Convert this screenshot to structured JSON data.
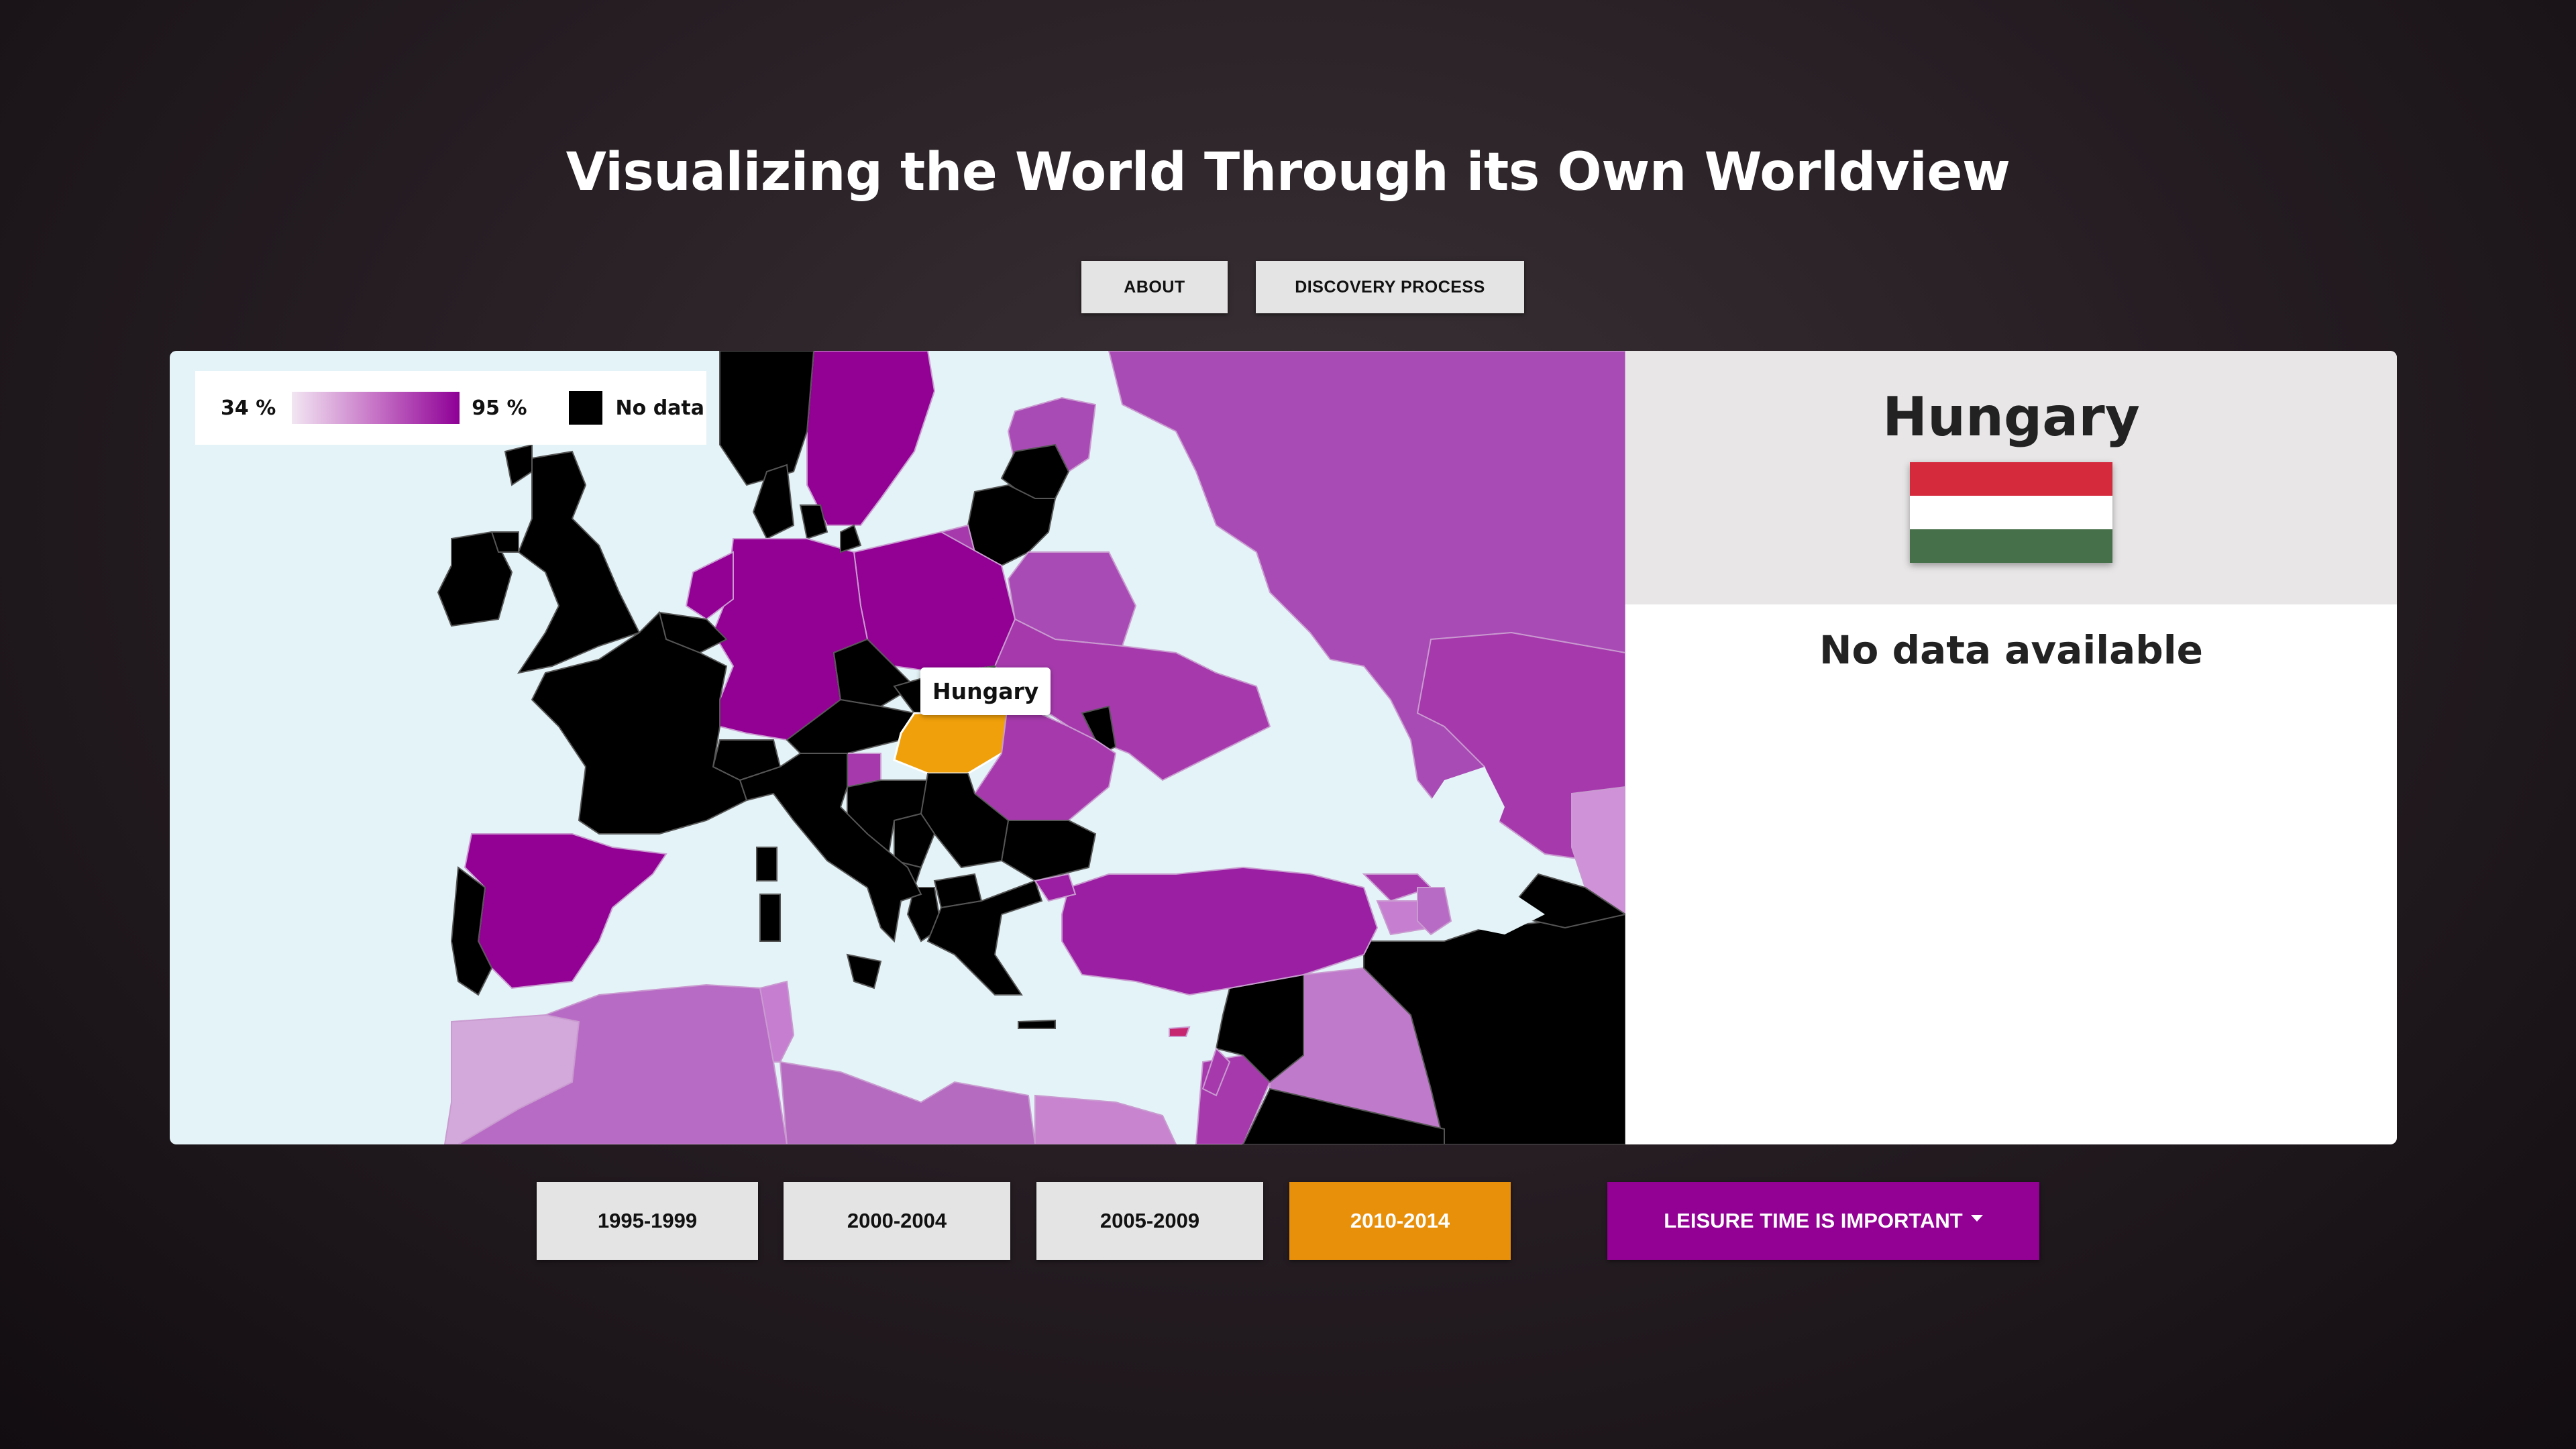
{
  "header": {
    "title": "Visualizing the World Through its Own Worldview"
  },
  "nav": {
    "about_label": "ABOUT",
    "discovery_label": "DISCOVERY PROCESS"
  },
  "legend": {
    "min_label": "34 %",
    "max_label": "95 %",
    "no_data_label": "No data"
  },
  "map": {
    "tooltip": "Hungary",
    "colors": {
      "water": "#e4f3f7",
      "no_data": "#000000",
      "highlight": "#f0a00a",
      "high": "#8e0096",
      "mid": "#a63aad",
      "low": "#d3a8da"
    }
  },
  "info": {
    "country": "Hungary",
    "message": "No data available",
    "flag_colors": [
      "#d42a3c",
      "#ffffff",
      "#46704a"
    ]
  },
  "periods": [
    {
      "label": "1995-1999",
      "active": false
    },
    {
      "label": "2000-2004",
      "active": false
    },
    {
      "label": "2005-2009",
      "active": false
    },
    {
      "label": "2010-2014",
      "active": true
    }
  ],
  "indicator": {
    "label": "LEISURE TIME IS IMPORTANT"
  }
}
